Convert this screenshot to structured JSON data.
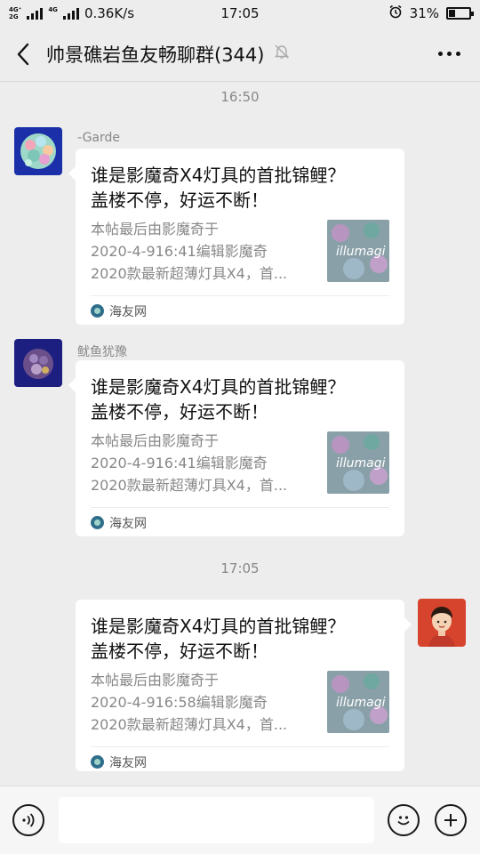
{
  "status_bar": {
    "network_a": "4G⁺",
    "network_b": "2G",
    "network_c": "4G",
    "speed": "0.36K/s",
    "time": "17:05",
    "battery_percent": "31%",
    "battery_level": 0.31
  },
  "nav": {
    "title": "帅景礁岩鱼友畅聊群(344)"
  },
  "messages": [
    {
      "timestamp": "16:50",
      "sender": "-Garde",
      "title": "谁是影魔奇X4灯具的首批锦鲤？\n盖楼不停，好运不断！",
      "desc": "本帖最后由影魔奇于\n2020-4-916:41编辑影魔奇\n2020款最新超薄灯具X4，首...",
      "thumb_label": "illumagi",
      "source": "海友网"
    },
    {
      "sender": "鱿鱼犹豫",
      "title": "谁是影魔奇X4灯具的首批锦鲤？\n盖楼不停，好运不断！",
      "desc": "本帖最后由影魔奇于\n2020-4-916:41编辑影魔奇\n2020款最新超薄灯具X4，首...",
      "thumb_label": "illumagi",
      "source": "海友网"
    },
    {
      "timestamp": "17:05",
      "title": "谁是影魔奇X4灯具的首批锦鲤？\n盖楼不停，好运不断！",
      "desc": "本帖最后由影魔奇于\n2020-4-916:58编辑影魔奇\n2020款最新超薄灯具X4，首...",
      "thumb_label": "illumagi",
      "source": "海友网"
    }
  ],
  "input": {
    "value": ""
  },
  "colors": {
    "background": "#ededed",
    "bubble": "#ffffff",
    "muted_text": "#888888"
  }
}
